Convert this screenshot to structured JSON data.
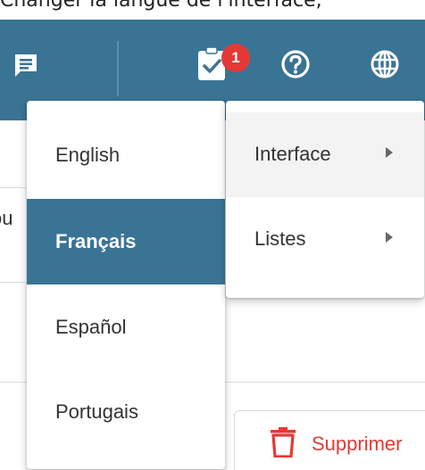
{
  "top_strip_text": "Changer la langue de l'interface,",
  "header": {
    "notification_count": "1",
    "colors": {
      "bar": "#3a7494",
      "badge": "#e53935"
    },
    "icons": [
      "chat-icon",
      "clipboard-check-icon",
      "help-icon",
      "globe-icon"
    ]
  },
  "page": {
    "clipped_text": "ou",
    "delete_label": "Supprimer"
  },
  "language_menu": {
    "items": [
      {
        "label": "English",
        "selected": false
      },
      {
        "label": "Français",
        "selected": true
      },
      {
        "label": "Español",
        "selected": false
      },
      {
        "label": "Portugais",
        "selected": false
      }
    ]
  },
  "submenu": {
    "items": [
      {
        "label": "Interface",
        "has_arrow": true,
        "hover": true
      },
      {
        "label": "Listes",
        "has_arrow": true,
        "hover": false
      }
    ]
  }
}
